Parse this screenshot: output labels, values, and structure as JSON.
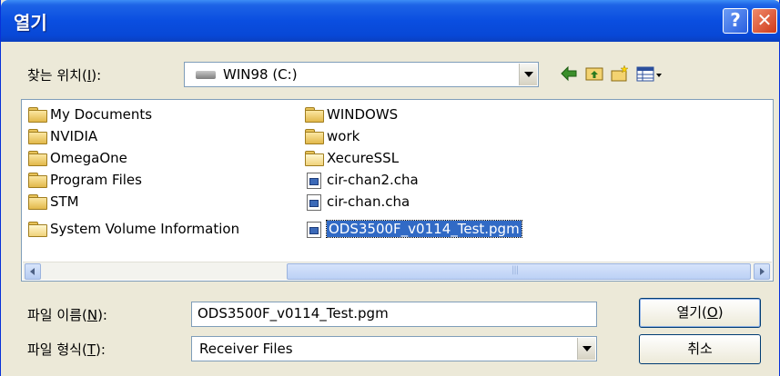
{
  "window": {
    "title": "열기"
  },
  "titlebar": {
    "help_label": "?",
    "close_label": "✕"
  },
  "lookin": {
    "label_prefix": "찾는 위치(",
    "label_key": "I",
    "label_suffix": "):",
    "value": "WIN98 (C:)",
    "icon": "hard-drive-icon"
  },
  "toolbar": [
    "back-icon",
    "up-folder-icon",
    "new-folder-icon",
    "view-menu-icon"
  ],
  "files": {
    "col1": [
      {
        "name": "My Documents",
        "icon": "folder-icon"
      },
      {
        "name": "NVIDIA",
        "icon": "folder-icon"
      },
      {
        "name": "OmegaOne",
        "icon": "folder-icon"
      },
      {
        "name": "Program Files",
        "icon": "folder-icon"
      },
      {
        "name": "STM",
        "icon": "folder-icon"
      },
      {
        "name": "System Volume Information",
        "icon": "folder-icon"
      }
    ],
    "col2": [
      {
        "name": "WINDOWS",
        "icon": "folder-icon"
      },
      {
        "name": "work",
        "icon": "folder-icon"
      },
      {
        "name": "XecureSSL",
        "icon": "folder-icon"
      },
      {
        "name": "cir-chan2.cha",
        "icon": "file-icon"
      },
      {
        "name": "cir-chan.cha",
        "icon": "file-icon"
      },
      {
        "name": "ODS3500F_v0114_Test.pgm",
        "icon": "file-icon",
        "selected": true
      }
    ]
  },
  "filename": {
    "label_prefix": "파일 이름(",
    "label_key": "N",
    "label_suffix": "):",
    "value": "ODS3500F_v0114_Test.pgm"
  },
  "filetype": {
    "label_prefix": "파일 형식(",
    "label_key": "T",
    "label_suffix": "):",
    "value": "Receiver Files"
  },
  "buttons": {
    "open_prefix": "열기(",
    "open_key": "O",
    "open_suffix": ")",
    "cancel_label": "취소"
  },
  "colors": {
    "titlebar": "#0a4ee0",
    "selection": "#316ac5",
    "face": "#ece9d8"
  }
}
